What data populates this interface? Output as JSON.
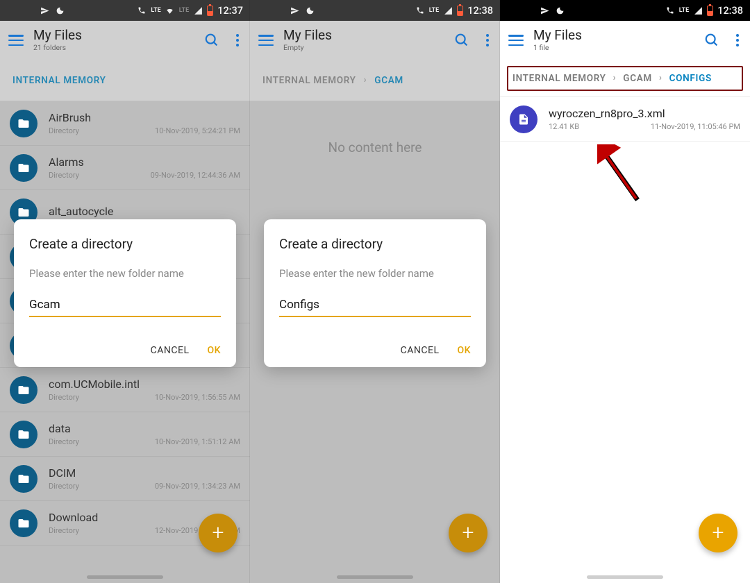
{
  "panel1": {
    "status": {
      "time": "12:37",
      "lte": "LTE"
    },
    "appbar": {
      "title": "My Files",
      "subtitle": "21 folders"
    },
    "crumbs": [
      {
        "label": "INTERNAL MEMORY",
        "active": true
      }
    ],
    "files": [
      {
        "name": "AirBrush",
        "type": "Directory",
        "date": "10-Nov-2019, 5:24:21 PM"
      },
      {
        "name": "Alarms",
        "type": "Directory",
        "date": "09-Nov-2019, 12:44:36 AM"
      },
      {
        "name": "alt_autocycle",
        "type": "",
        "date": ""
      },
      {
        "name": "",
        "type": "",
        "date": ""
      },
      {
        "name": "",
        "type": "",
        "date": ""
      },
      {
        "name": "",
        "type": "",
        "date": ""
      },
      {
        "name": "com.UCMobile.intl",
        "type": "Directory",
        "date": "10-Nov-2019, 1:56:55 AM"
      },
      {
        "name": "data",
        "type": "Directory",
        "date": "10-Nov-2019, 1:51:12 AM"
      },
      {
        "name": "DCIM",
        "type": "Directory",
        "date": "09-Nov-2019, 1:34:23 AM"
      },
      {
        "name": "Download",
        "type": "Directory",
        "date": "12-Nov-2019, 2:36:55 AM"
      }
    ],
    "dialog": {
      "title": "Create a directory",
      "hint": "Please enter the new folder name",
      "value": "Gcam",
      "cancel": "CANCEL",
      "ok": "OK"
    }
  },
  "panel2": {
    "status": {
      "time": "12:38",
      "lte": "LTE"
    },
    "appbar": {
      "title": "My Files",
      "subtitle": "Empty"
    },
    "crumbs": [
      {
        "label": "INTERNAL MEMORY",
        "active": false
      },
      {
        "label": "GCAM",
        "active": true
      }
    ],
    "empty_text": "No content here",
    "dialog": {
      "title": "Create a directory",
      "hint": "Please enter the new folder name",
      "value": "Configs",
      "cancel": "CANCEL",
      "ok": "OK"
    }
  },
  "panel3": {
    "status": {
      "time": "12:38",
      "lte": "LTE"
    },
    "appbar": {
      "title": "My Files",
      "subtitle": "1 file"
    },
    "crumbs": [
      {
        "label": "INTERNAL MEMORY",
        "active": false
      },
      {
        "label": "GCAM",
        "active": false
      },
      {
        "label": "CONFIGS",
        "active": true
      }
    ],
    "files": [
      {
        "name": "wyroczen_rn8pro_3.xml",
        "size": "12.41 KB",
        "date": "11-Nov-2019, 11:05:46 PM"
      }
    ]
  }
}
